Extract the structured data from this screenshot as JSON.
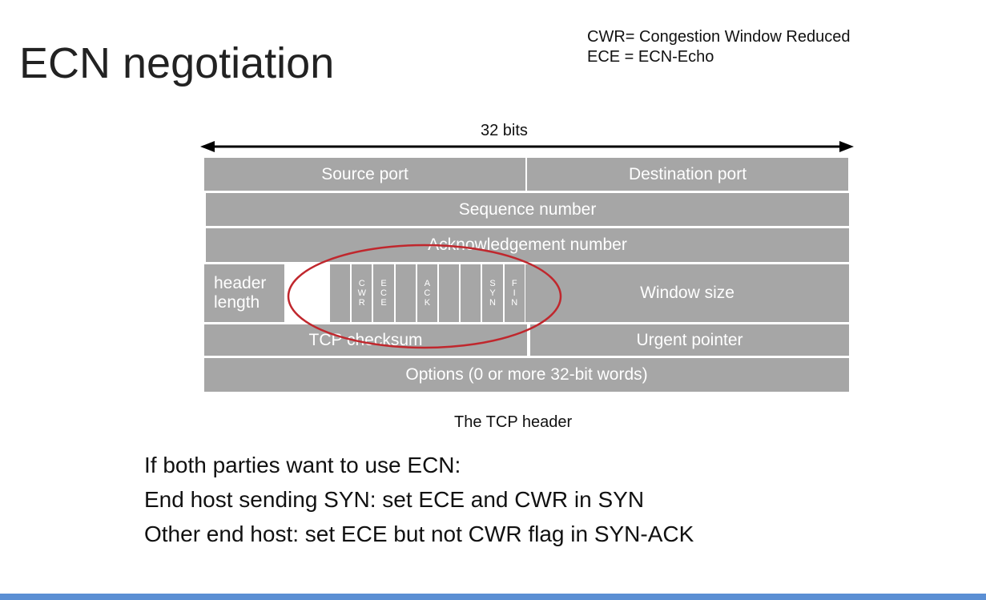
{
  "title": "ECN negotiation",
  "legend": {
    "line1": "CWR= Congestion Window Reduced",
    "line2": "ECE = ECN-Echo"
  },
  "diagram": {
    "width_label": "32 bits",
    "row1": {
      "left": "Source port",
      "right": "Destination port"
    },
    "row2": "Sequence number",
    "row3": "Acknowledgement number",
    "row4": {
      "header_length": "header length",
      "flags": [
        {
          "name": "blank1",
          "letters": []
        },
        {
          "name": "cwr",
          "letters": [
            "C",
            "W",
            "R"
          ]
        },
        {
          "name": "ece",
          "letters": [
            "E",
            "C",
            "E"
          ]
        },
        {
          "name": "urg",
          "letters": []
        },
        {
          "name": "ack",
          "letters": [
            "A",
            "C",
            "K"
          ]
        },
        {
          "name": "psh",
          "letters": []
        },
        {
          "name": "rst",
          "letters": []
        },
        {
          "name": "syn",
          "letters": [
            "S",
            "Y",
            "N"
          ]
        },
        {
          "name": "fin",
          "letters": [
            "F",
            "I",
            "N"
          ]
        }
      ],
      "window": "Window size"
    },
    "row5": {
      "left": "TCP checksum",
      "right": "Urgent pointer"
    },
    "row6": "Options (0 or more 32-bit words)",
    "caption": "The TCP header",
    "highlight_color": "#c0272d"
  },
  "bullets": [
    "If both parties want to use ECN:",
    "End host sending SYN: set ECE and CWR in SYN",
    "Other end host: set ECE but not CWR flag in SYN-ACK"
  ],
  "colors": {
    "box": "#a6a6a6",
    "accent_bar": "#5b8fd4"
  }
}
